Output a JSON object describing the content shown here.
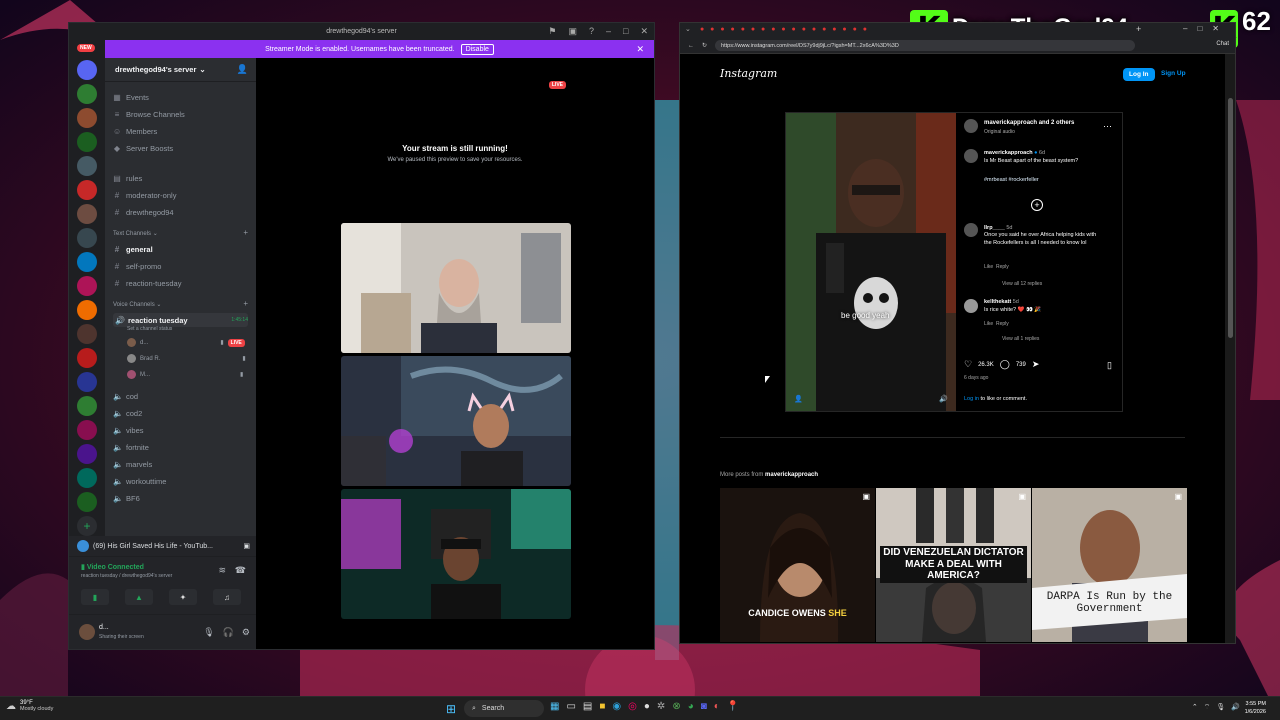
{
  "overlay": {
    "streamer_name": "DrewTheGod94",
    "kick_letter": "K",
    "viewer_count": "62"
  },
  "discord": {
    "window_title": "drewthegod94's server",
    "banner_text": "Streamer Mode is enabled. Usernames have been truncated.",
    "banner_button": "Disable",
    "new_badge": "NEW",
    "server_name": "drewthegod94's server",
    "top_items": [
      "Events",
      "Browse Channels",
      "Members",
      "Server Boosts"
    ],
    "channels_top": [
      "rules",
      "moderator-only",
      "drewthegod94"
    ],
    "text_category": "Text Channels",
    "text_channels": [
      "general",
      "self-promo",
      "reaction-tuesday"
    ],
    "voice_category": "Voice Channels",
    "active_voice": "reaction tuesday",
    "active_voice_time": "1:45:14",
    "set_status": "Set a channel status",
    "voice_users": [
      "d...",
      "Brad R.",
      "M..."
    ],
    "live_badge": "LIVE",
    "voice_channels": [
      "cod",
      "cod2",
      "vibes",
      "fortnite",
      "marvels",
      "workouttime",
      "BF6"
    ],
    "music_activity": "(69) His Girl Saved His Life - YouTub...",
    "voice_connected": "Video Connected",
    "voice_connected_sub": "reaction tuesday / drewthegod94's server",
    "user_name": "d...",
    "user_status": "Sharing their screen",
    "stage_live": "LIVE",
    "stage_title": "Your stream is still running!",
    "stage_subtitle": "We've paused this preview to save your resources."
  },
  "browser": {
    "url": "https://www.instagram.com/reel/DS7y9dj9jLc/?igsh=MT...2x6cA%3D%3D",
    "chat_label": "Chat"
  },
  "instagram": {
    "logo": "Instagram",
    "login_button": "Log In",
    "signup_link": "Sign Up",
    "post_header": "maverickapproach and 2 others",
    "post_audio": "Original audio",
    "author": "maverickapproach",
    "author_time": "6d",
    "caption": "Is Mr Beast apart of the beast system?",
    "hashtags": "#mrbeast #rockerfeller",
    "video_caption": "be good yeah",
    "comments": [
      {
        "user": "llrp____",
        "time": "5d",
        "text": "Once you said he over Africa helping kids with the Rockefellers is all I needed to know lol",
        "like": "Like",
        "reply": "Reply",
        "view_replies": "View all 12 replies"
      },
      {
        "user": "kellthekatt",
        "time": "5d",
        "text": "Is rice white? ❤️ 👀 🎉",
        "like": "Like",
        "reply": "Reply",
        "view_replies": "View all 1 replies"
      }
    ],
    "likes": "26.3K",
    "comment_count": "739",
    "date": "6 days ago",
    "login_prompt_link": "Log in",
    "login_prompt_rest": "to like or comment.",
    "more_posts_prefix": "More posts from",
    "more_posts_user": "maverickapproach",
    "thumbnails": [
      {
        "label": "CANDICE OWENS SHE",
        "highlight": "SHE"
      },
      {
        "label": "DID VENEZUELAN DICTATOR MAKE A DEAL WITH AMERICA?"
      },
      {
        "label": "DARPA Is Run by the Government"
      }
    ]
  },
  "taskbar": {
    "temperature": "39°F",
    "weather": "Mostly cloudy",
    "search_label": "Search",
    "time": "3:55 PM",
    "date": "1/6/2026"
  },
  "colors": {
    "discord_purple": "#8b31f0",
    "instagram_blue": "#0095f6",
    "kick_green": "#53fc18",
    "live_red": "#ed4245"
  }
}
